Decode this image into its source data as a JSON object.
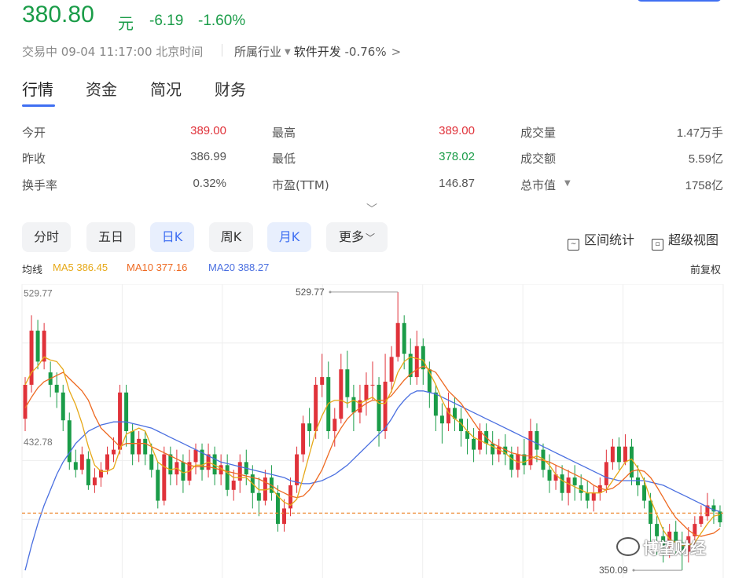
{
  "header": {
    "price": "380.80",
    "unit": "元",
    "change": "-6.19",
    "change_pct": "-1.60%",
    "status": "交易中 09-04 11:17:00 北京时间",
    "industry_label": "所属行业",
    "industry_name": "软件开发",
    "industry_change": "-0.76%"
  },
  "tabs": [
    "行情",
    "资金",
    "简况",
    "财务"
  ],
  "stats": [
    {
      "label": "今开",
      "value": "389.00",
      "color": "#e0323a"
    },
    {
      "label": "最高",
      "value": "389.00",
      "color": "#e0323a"
    },
    {
      "label": "成交量",
      "value": "1.47万手",
      "color": "#555555"
    },
    {
      "label": "昨收",
      "value": "386.99",
      "color": "#555555"
    },
    {
      "label": "最低",
      "value": "378.02",
      "color": "#1a9c48"
    },
    {
      "label": "成交额",
      "value": "5.59亿",
      "color": "#555555"
    },
    {
      "label": "换手率",
      "value": "0.32%",
      "color": "#555555"
    },
    {
      "label": "市盈(TTM)",
      "value": "146.87",
      "color": "#555555"
    },
    {
      "label": "总市值",
      "value": "1758亿",
      "color": "#555555"
    }
  ],
  "periods": [
    "分时",
    "五日",
    "日K",
    "周K",
    "月K",
    "更多"
  ],
  "tools": {
    "range_stats": "区间统计",
    "super_view": "超级视图"
  },
  "legend": {
    "label": "均线",
    "ma5": "MA5 386.45",
    "ma10": "MA10 377.16",
    "ma20": "MA20 388.27",
    "adjust": "前复权"
  },
  "colors": {
    "up": "#e0323a",
    "down": "#1a9c48",
    "ma5": "#e6a817",
    "ma10": "#ee6a22",
    "ma20": "#4a6fe0",
    "accent": "#3f6ff2"
  },
  "watermark": "博望财经",
  "chart_data": {
    "type": "candlestick",
    "y_labels": [
      "529.77",
      "432.78"
    ],
    "high_marker": "529.77",
    "low_marker": "350.09",
    "ref_line": 386.99,
    "ylim": [
      345,
      535
    ],
    "candles": [
      [
        448,
        470,
        475,
        440
      ],
      [
        470,
        505,
        515,
        465
      ],
      [
        505,
        485,
        512,
        480
      ],
      [
        485,
        505,
        510,
        480
      ],
      [
        478,
        470,
        485,
        462
      ],
      [
        470,
        465,
        478,
        455
      ],
      [
        465,
        447,
        470,
        440
      ],
      [
        447,
        420,
        452,
        415
      ],
      [
        420,
        415,
        428,
        410
      ],
      [
        415,
        425,
        430,
        412
      ],
      [
        422,
        405,
        427,
        402
      ],
      [
        405,
        410,
        416,
        400
      ],
      [
        410,
        415,
        420,
        404
      ],
      [
        415,
        425,
        430,
        412
      ],
      [
        425,
        428,
        436,
        420
      ],
      [
        428,
        465,
        470,
        425
      ],
      [
        465,
        440,
        470,
        430
      ],
      [
        440,
        425,
        445,
        418
      ],
      [
        425,
        435,
        440,
        420
      ],
      [
        435,
        425,
        440,
        418
      ],
      [
        425,
        415,
        432,
        410
      ],
      [
        415,
        395,
        420,
        390
      ],
      [
        395,
        425,
        430,
        392
      ],
      [
        425,
        412,
        430,
        405
      ],
      [
        412,
        420,
        428,
        405
      ],
      [
        420,
        408,
        425,
        400
      ],
      [
        408,
        420,
        428,
        405
      ],
      [
        420,
        428,
        432,
        412
      ],
      [
        428,
        415,
        432,
        408
      ],
      [
        415,
        425,
        432,
        410
      ],
      [
        425,
        412,
        430,
        405
      ],
      [
        412,
        418,
        425,
        405
      ],
      [
        418,
        402,
        425,
        398
      ],
      [
        402,
        408,
        415,
        395
      ],
      [
        408,
        420,
        425,
        400
      ],
      [
        420,
        412,
        428,
        405
      ],
      [
        412,
        400,
        418,
        390
      ],
      [
        400,
        395,
        410,
        385
      ],
      [
        395,
        410,
        415,
        392
      ],
      [
        410,
        400,
        418,
        395
      ],
      [
        400,
        380,
        405,
        375
      ],
      [
        380,
        390,
        396,
        375
      ],
      [
        390,
        405,
        410,
        385
      ],
      [
        405,
        425,
        430,
        400
      ],
      [
        425,
        445,
        450,
        420
      ],
      [
        445,
        440,
        455,
        430
      ],
      [
        440,
        470,
        475,
        435
      ],
      [
        470,
        475,
        490,
        462
      ],
      [
        475,
        440,
        485,
        435
      ],
      [
        440,
        448,
        455,
        430
      ],
      [
        448,
        480,
        490,
        445
      ],
      [
        480,
        462,
        492,
        455
      ],
      [
        462,
        452,
        470,
        440
      ],
      [
        452,
        460,
        470,
        445
      ],
      [
        460,
        470,
        478,
        450
      ],
      [
        470,
        470,
        485,
        460
      ],
      [
        470,
        440,
        475,
        430
      ],
      [
        440,
        472,
        490,
        435
      ],
      [
        472,
        488,
        495,
        465
      ],
      [
        488,
        510,
        530,
        485
      ],
      [
        510,
        490,
        515,
        480
      ],
      [
        490,
        475,
        500,
        470
      ],
      [
        475,
        495,
        505,
        470
      ],
      [
        495,
        480,
        500,
        470
      ],
      [
        480,
        465,
        485,
        455
      ],
      [
        465,
        450,
        470,
        440
      ],
      [
        450,
        445,
        458,
        432
      ],
      [
        445,
        455,
        465,
        440
      ],
      [
        455,
        448,
        462,
        440
      ],
      [
        448,
        440,
        455,
        430
      ],
      [
        440,
        435,
        448,
        425
      ],
      [
        435,
        428,
        442,
        420
      ],
      [
        428,
        440,
        445,
        425
      ],
      [
        440,
        432,
        445,
        425
      ],
      [
        432,
        425,
        440,
        418
      ],
      [
        425,
        430,
        435,
        420
      ],
      [
        430,
        425,
        438,
        418
      ],
      [
        425,
        415,
        430,
        410
      ],
      [
        415,
        425,
        430,
        410
      ],
      [
        425,
        418,
        435,
        412
      ],
      [
        418,
        440,
        448,
        415
      ],
      [
        440,
        428,
        445,
        420
      ],
      [
        428,
        415,
        432,
        410
      ],
      [
        415,
        408,
        425,
        400
      ],
      [
        408,
        412,
        418,
        402
      ],
      [
        412,
        400,
        418,
        395
      ],
      [
        400,
        410,
        415,
        392
      ],
      [
        410,
        405,
        418,
        395
      ],
      [
        405,
        400,
        412,
        395
      ],
      [
        400,
        395,
        408,
        390
      ],
      [
        395,
        400,
        405,
        388
      ],
      [
        400,
        405,
        410,
        395
      ],
      [
        405,
        420,
        428,
        400
      ],
      [
        420,
        430,
        435,
        415
      ],
      [
        430,
        420,
        436,
        415
      ],
      [
        420,
        430,
        438,
        418
      ],
      [
        430,
        410,
        435,
        405
      ],
      [
        410,
        405,
        418,
        398
      ],
      [
        405,
        395,
        410,
        390
      ],
      [
        395,
        380,
        400,
        365
      ],
      [
        380,
        372,
        385,
        360
      ],
      [
        372,
        365,
        378,
        355
      ],
      [
        365,
        375,
        380,
        358
      ],
      [
        375,
        368,
        382,
        360
      ],
      [
        368,
        362,
        375,
        350
      ],
      [
        362,
        372,
        378,
        355
      ],
      [
        372,
        380,
        385,
        365
      ],
      [
        380,
        385,
        392,
        378
      ],
      [
        385,
        392,
        400,
        382
      ],
      [
        392,
        388,
        396,
        380
      ],
      [
        388,
        381,
        392,
        378
      ]
    ],
    "ma5": [
      470,
      478,
      482,
      488,
      486,
      485,
      480,
      466,
      457,
      445,
      430,
      418,
      414,
      414,
      416,
      428,
      438,
      440,
      442,
      440,
      430,
      420,
      417,
      415,
      416,
      413,
      414,
      418,
      418,
      420,
      418,
      416,
      413,
      410,
      410,
      410,
      406,
      402,
      402,
      403,
      398,
      394,
      392,
      396,
      410,
      425,
      440,
      450,
      458,
      460,
      460,
      458,
      460,
      458,
      460,
      462,
      458,
      458,
      466,
      478,
      485,
      488,
      487,
      486,
      478,
      470,
      460,
      452,
      448,
      445,
      440,
      436,
      434,
      432,
      430,
      428,
      426,
      422,
      420,
      420,
      422,
      424,
      422,
      418,
      412,
      408,
      406,
      404,
      402,
      400,
      400,
      400,
      402,
      408,
      414,
      420,
      422,
      416,
      408,
      396,
      386,
      376,
      370,
      368,
      366,
      366,
      368,
      374,
      380,
      385,
      386
    ],
    "ma10": [
      455,
      462,
      468,
      472,
      474,
      476,
      478,
      474,
      470,
      466,
      460,
      450,
      442,
      438,
      434,
      430,
      432,
      432,
      432,
      432,
      430,
      428,
      426,
      424,
      422,
      420,
      418,
      417,
      417,
      417,
      416,
      415,
      414,
      413,
      412,
      411,
      410,
      409,
      407,
      405,
      402,
      400,
      398,
      397,
      398,
      402,
      408,
      415,
      425,
      435,
      442,
      448,
      452,
      455,
      458,
      460,
      460,
      460,
      463,
      468,
      473,
      477,
      480,
      482,
      480,
      478,
      472,
      466,
      462,
      458,
      452,
      446,
      440,
      436,
      432,
      430,
      428,
      426,
      425,
      424,
      424,
      422,
      421,
      420,
      418,
      416,
      414,
      412,
      410,
      408,
      405,
      403,
      402,
      403,
      406,
      410,
      414,
      415,
      414,
      410,
      404,
      397,
      390,
      384,
      380,
      376,
      373,
      372,
      373,
      374,
      377
    ],
    "ma20": [
      350,
      366,
      380,
      392,
      402,
      412,
      420,
      426,
      432,
      436,
      440,
      442,
      444,
      445,
      446,
      446,
      446,
      445,
      444,
      443,
      442,
      440,
      438,
      436,
      434,
      432,
      430,
      428,
      426,
      424,
      422,
      420,
      419,
      418,
      417,
      416,
      415,
      414,
      413,
      412,
      411,
      410,
      408,
      407,
      406,
      406,
      407,
      408,
      410,
      412,
      415,
      418,
      422,
      426,
      430,
      434,
      438,
      442,
      448,
      455,
      460,
      464,
      466,
      466,
      465,
      464,
      462,
      460,
      458,
      456,
      454,
      452,
      450,
      448,
      446,
      444,
      442,
      440,
      438,
      436,
      434,
      432,
      430,
      428,
      426,
      424,
      422,
      420,
      418,
      416,
      414,
      412,
      410,
      409,
      408,
      408,
      408,
      408,
      408,
      407,
      406,
      405,
      403,
      401,
      399,
      397,
      395,
      393,
      391,
      389,
      388
    ]
  }
}
